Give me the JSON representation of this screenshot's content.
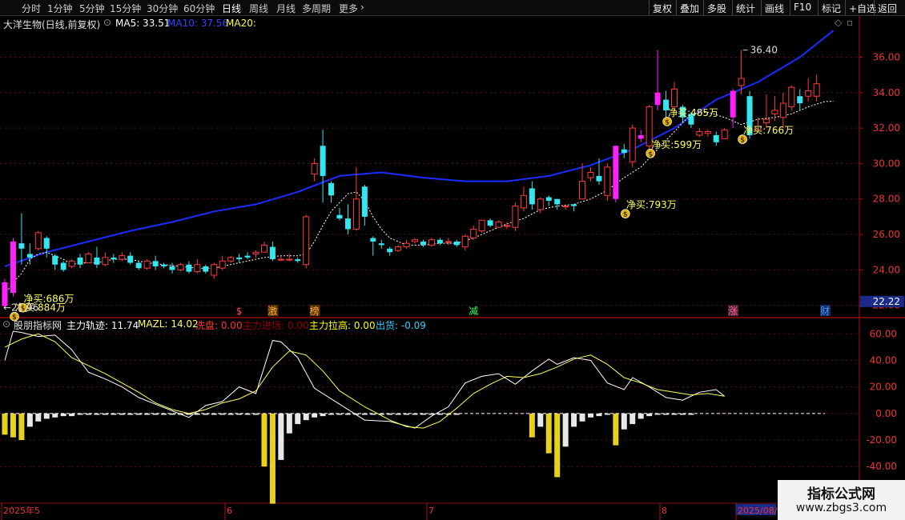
{
  "toolbar": {
    "periods": [
      "分时",
      "1分钟",
      "5分钟",
      "15分钟",
      "30分钟",
      "60分钟",
      "日线",
      "周线",
      "月线",
      "多周期",
      "更多"
    ],
    "active_period": "日线",
    "right_buttons": [
      "复权",
      "叠加",
      "多股",
      "统计",
      "画线",
      "F10",
      "标记",
      "+自选",
      "返回"
    ]
  },
  "main_header": {
    "stock": "大洋生物(日线,前复权)",
    "ma5_label": "MA5: 33.51",
    "ma10_label": "MA10: 37.56",
    "ma20_label": "MA20:"
  },
  "sub_header": {
    "name": "股朋指标网",
    "items": [
      {
        "text": "主力轨迹: 11.74",
        "color": "#ffffff"
      },
      {
        "text": "MAZL: 14.02",
        "color": "#ffff66"
      },
      {
        "text": "洗盘: 0.00",
        "color": "#ff3333"
      },
      {
        "text": "主力进场: 0.00",
        "color": "#990000"
      },
      {
        "text": "主力拉高: 0.00",
        "color": "#ffff00"
      },
      {
        "text": "出货: -0.09",
        "color": "#33ccff"
      }
    ]
  },
  "price_axis": [
    "36.00",
    "34.00",
    "32.00",
    "30.00",
    "28.00",
    "26.00",
    "24.00",
    "22.00"
  ],
  "price_tag": "22.22",
  "ind_axis": [
    "60.00",
    "40.00",
    "20.00",
    "0.00",
    "-20.00",
    "-40.00"
  ],
  "date_labels": [
    "2025年5",
    "6",
    "7",
    "8",
    "2025/08/"
  ],
  "annotations": {
    "high_price": "36.40",
    "low_price": "21.96",
    "buys": [
      "净买:884万",
      "净买:686万",
      "净买:793万",
      "净买:599万",
      "净买:485万",
      "净买:766万"
    ],
    "event_markers": [
      "$",
      "激",
      "榜",
      "减",
      "涨",
      "财"
    ]
  },
  "watermark": {
    "title": "指标公式网",
    "url": "www.zbgs3.com"
  },
  "chart_data": {
    "type": "candlestick",
    "ylim": [
      21.4,
      37.6
    ],
    "candles": [
      [
        21.96,
        23.3,
        22.0,
        23.5
      ],
      [
        22.7,
        25.6,
        22.5,
        25.8
      ],
      [
        25.5,
        25.2,
        24.3,
        27.2
      ],
      [
        24.9,
        24.7,
        24.3,
        25.5
      ],
      [
        25.2,
        26.1,
        25.1,
        26.2
      ],
      [
        25.8,
        25.2,
        24.7,
        25.9
      ],
      [
        24.8,
        24.3,
        24.0,
        24.9
      ],
      [
        24.4,
        24.0,
        23.9,
        24.5
      ],
      [
        24.2,
        24.5,
        24.1,
        24.6
      ],
      [
        24.7,
        24.3,
        24.1,
        24.9
      ],
      [
        24.4,
        24.9,
        24.4,
        25.0
      ],
      [
        24.7,
        24.3,
        24.1,
        25.3
      ],
      [
        24.3,
        24.7,
        24.2,
        25.0
      ],
      [
        24.7,
        24.6,
        24.4,
        24.9
      ],
      [
        24.6,
        24.8,
        24.5,
        25.0
      ],
      [
        24.8,
        24.4,
        24.3,
        25.0
      ],
      [
        24.4,
        24.1,
        24.0,
        24.5
      ],
      [
        24.1,
        24.5,
        24.0,
        24.6
      ],
      [
        24.5,
        24.2,
        24.0,
        24.8
      ],
      [
        24.3,
        24.2,
        24.1,
        24.4
      ],
      [
        24.2,
        24.0,
        23.8,
        24.4
      ],
      [
        24.0,
        24.3,
        23.9,
        24.4
      ],
      [
        24.3,
        23.9,
        23.8,
        24.5
      ],
      [
        23.9,
        24.3,
        23.8,
        24.6
      ],
      [
        24.2,
        23.9,
        23.8,
        24.3
      ],
      [
        23.7,
        24.3,
        23.5,
        24.4
      ],
      [
        24.1,
        24.5,
        24.0,
        24.8
      ],
      [
        24.5,
        24.7,
        24.4,
        24.8
      ],
      [
        24.7,
        24.6,
        24.4,
        24.9
      ],
      [
        24.8,
        24.7,
        24.6,
        25.0
      ],
      [
        24.9,
        25.0,
        24.7,
        25.1
      ],
      [
        25.0,
        25.4,
        25.0,
        25.6
      ],
      [
        25.3,
        24.6,
        24.5,
        25.6
      ],
      [
        24.6,
        24.6,
        24.5,
        24.8
      ],
      [
        24.6,
        24.6,
        24.5,
        24.9
      ],
      [
        24.6,
        24.5,
        24.4,
        24.7
      ],
      [
        24.3,
        27.0,
        24.1,
        27.1
      ],
      [
        29.4,
        30.0,
        29.0,
        30.3
      ],
      [
        31.0,
        29.3,
        27.8,
        31.9
      ],
      [
        28.9,
        28.2,
        27.8,
        29.0
      ],
      [
        27.1,
        26.9,
        26.8,
        27.5
      ],
      [
        26.9,
        26.3,
        26.0,
        27.7
      ],
      [
        26.3,
        28.0,
        26.2,
        29.8
      ],
      [
        28.7,
        27.0,
        26.5,
        28.8
      ],
      [
        25.8,
        25.6,
        24.8,
        25.9
      ],
      [
        25.5,
        25.4,
        25.2,
        25.7
      ],
      [
        25.2,
        25.0,
        24.8,
        25.3
      ],
      [
        25.1,
        25.3,
        25.0,
        25.4
      ],
      [
        25.3,
        25.5,
        25.2,
        25.7
      ],
      [
        25.6,
        25.7,
        25.5,
        25.8
      ],
      [
        25.6,
        25.4,
        25.3,
        25.7
      ],
      [
        25.4,
        25.7,
        25.3,
        25.8
      ],
      [
        25.7,
        25.5,
        25.4,
        25.8
      ],
      [
        25.6,
        25.6,
        25.4,
        25.8
      ],
      [
        25.6,
        25.4,
        25.3,
        25.7
      ],
      [
        25.3,
        25.9,
        25.1,
        26.0
      ],
      [
        25.8,
        26.3,
        25.7,
        26.5
      ],
      [
        26.2,
        26.8,
        26.1,
        26.8
      ],
      [
        26.8,
        26.5,
        26.4,
        26.9
      ],
      [
        26.4,
        26.7,
        26.4,
        26.8
      ],
      [
        26.5,
        26.5,
        26.3,
        26.7
      ],
      [
        26.4,
        27.6,
        26.2,
        27.8
      ],
      [
        27.5,
        28.2,
        27.3,
        28.7
      ],
      [
        28.6,
        27.7,
        27.4,
        29.0
      ],
      [
        27.4,
        28.0,
        27.2,
        28.1
      ],
      [
        28.1,
        27.9,
        27.6,
        28.2
      ],
      [
        28.0,
        27.7,
        27.4,
        28.0
      ],
      [
        27.6,
        27.6,
        27.4,
        27.7
      ],
      [
        27.7,
        27.6,
        27.3,
        27.7
      ],
      [
        28.0,
        29.0,
        28.0,
        30.0
      ],
      [
        29.2,
        29.5,
        29.0,
        29.8
      ],
      [
        29.3,
        29.0,
        28.8,
        30.3
      ],
      [
        28.2,
        29.8,
        27.9,
        30.0
      ],
      [
        28.0,
        31.0,
        27.8,
        31.0
      ],
      [
        30.8,
        30.6,
        30.3,
        31.1
      ],
      [
        30.1,
        32.0,
        29.8,
        32.2
      ],
      [
        31.4,
        31.6,
        31.2,
        31.9
      ],
      [
        31.0,
        33.2,
        30.8,
        33.3
      ],
      [
        33.3,
        34.0,
        33.0,
        36.4
      ],
      [
        33.6,
        33.0,
        32.6,
        34.1
      ],
      [
        33.2,
        34.2,
        33.0,
        34.6
      ],
      [
        33.2,
        32.6,
        32.3,
        33.3
      ],
      [
        32.8,
        32.2,
        32.0,
        32.9
      ],
      [
        31.6,
        31.8,
        31.5,
        32.0
      ],
      [
        31.7,
        31.8,
        31.5,
        31.9
      ],
      [
        31.6,
        31.2,
        31.0,
        31.8
      ],
      [
        31.4,
        31.9,
        31.4,
        32.0
      ],
      [
        32.6,
        34.1,
        32.0,
        34.2
      ],
      [
        34.4,
        34.8,
        33.9,
        36.4
      ],
      [
        33.8,
        31.6,
        31.4,
        34.1
      ],
      [
        31.9,
        32.1,
        31.9,
        32.6
      ],
      [
        32.3,
        32.5,
        32.0,
        33.9
      ],
      [
        32.8,
        33.0,
        32.4,
        33.8
      ],
      [
        32.6,
        33.4,
        32.0,
        34.0
      ],
      [
        33.2,
        34.3,
        33.0,
        34.4
      ],
      [
        33.8,
        33.4,
        33.0,
        34.2
      ],
      [
        33.8,
        34.1,
        33.5,
        34.8
      ],
      [
        33.8,
        34.5,
        33.5,
        35.0
      ]
    ],
    "buy_candles": [
      0,
      1,
      73,
      76,
      78,
      87
    ],
    "ma10": [
      [
        0,
        24.2
      ],
      [
        5,
        25.0
      ],
      [
        10,
        25.6
      ],
      [
        15,
        26.2
      ],
      [
        20,
        26.7
      ],
      [
        25,
        27.3
      ],
      [
        30,
        27.7
      ],
      [
        35,
        28.4
      ],
      [
        40,
        29.3
      ],
      [
        45,
        29.5
      ],
      [
        50,
        29.2
      ],
      [
        55,
        29.0
      ],
      [
        60,
        29.0
      ],
      [
        65,
        29.3
      ],
      [
        70,
        29.9
      ],
      [
        75,
        30.8
      ],
      [
        80,
        32.0
      ],
      [
        85,
        33.6
      ],
      [
        90,
        34.6
      ],
      [
        95,
        36.0
      ],
      [
        99,
        37.5
      ]
    ],
    "ma5": [
      [
        0,
        22.6
      ],
      [
        1,
        23.3
      ],
      [
        2,
        23.8
      ],
      [
        3,
        24.6
      ],
      [
        4,
        24.9
      ],
      [
        5,
        25.0
      ],
      [
        6,
        24.8
      ],
      [
        7,
        24.6
      ],
      [
        8,
        24.3
      ],
      [
        9,
        24.4
      ],
      [
        11,
        24.4
      ],
      [
        13,
        24.6
      ],
      [
        15,
        24.6
      ],
      [
        17,
        24.4
      ],
      [
        19,
        24.3
      ],
      [
        21,
        24.2
      ],
      [
        23,
        24.1
      ],
      [
        25,
        24.1
      ],
      [
        27,
        24.3
      ],
      [
        29,
        24.5
      ],
      [
        31,
        24.7
      ],
      [
        33,
        24.8
      ],
      [
        35,
        24.8
      ],
      [
        36,
        24.9
      ],
      [
        37,
        25.6
      ],
      [
        38,
        26.5
      ],
      [
        39,
        27.3
      ],
      [
        40,
        27.8
      ],
      [
        41,
        28.3
      ],
      [
        42,
        28.4
      ],
      [
        43,
        27.9
      ],
      [
        44,
        27.0
      ],
      [
        45,
        26.3
      ],
      [
        46,
        25.8
      ],
      [
        48,
        25.4
      ],
      [
        50,
        25.4
      ],
      [
        52,
        25.5
      ],
      [
        54,
        25.5
      ],
      [
        56,
        25.8
      ],
      [
        58,
        26.2
      ],
      [
        60,
        26.6
      ],
      [
        62,
        26.9
      ],
      [
        64,
        27.4
      ],
      [
        66,
        27.6
      ],
      [
        68,
        27.7
      ],
      [
        70,
        28.0
      ],
      [
        72,
        28.5
      ],
      [
        74,
        29.2
      ],
      [
        76,
        29.8
      ],
      [
        78,
        30.8
      ],
      [
        80,
        31.8
      ],
      [
        82,
        32.8
      ],
      [
        84,
        32.9
      ],
      [
        86,
        32.6
      ],
      [
        88,
        32.2
      ],
      [
        90,
        32.5
      ],
      [
        92,
        32.6
      ],
      [
        94,
        32.8
      ],
      [
        96,
        33.2
      ],
      [
        98,
        33.5
      ],
      [
        99,
        33.51
      ]
    ],
    "main_line": [
      [
        0,
        40
      ],
      [
        1,
        62
      ],
      [
        2,
        61
      ],
      [
        4,
        58
      ],
      [
        6,
        59
      ],
      [
        8,
        48
      ],
      [
        10,
        31
      ],
      [
        12,
        26
      ],
      [
        14,
        20
      ],
      [
        16,
        12
      ],
      [
        18,
        7
      ],
      [
        20,
        2
      ],
      [
        22,
        -3
      ],
      [
        24,
        6
      ],
      [
        26,
        9
      ],
      [
        28,
        20
      ],
      [
        30,
        15
      ],
      [
        32,
        55
      ],
      [
        33,
        54
      ],
      [
        35,
        42
      ],
      [
        37,
        19
      ],
      [
        40,
        7
      ],
      [
        43,
        -5
      ],
      [
        46,
        -6
      ],
      [
        49,
        -11
      ],
      [
        51,
        -2
      ],
      [
        53,
        5
      ],
      [
        55,
        23
      ],
      [
        57,
        28
      ],
      [
        59,
        30
      ],
      [
        61,
        22
      ],
      [
        63,
        32
      ],
      [
        65,
        41
      ],
      [
        66,
        37
      ],
      [
        68,
        42
      ],
      [
        70,
        40
      ],
      [
        72,
        23
      ],
      [
        74,
        18
      ],
      [
        75,
        27
      ],
      [
        77,
        20
      ],
      [
        79,
        12
      ],
      [
        81,
        10
      ],
      [
        83,
        16
      ],
      [
        85,
        18
      ],
      [
        86,
        13
      ]
    ],
    "mazl_line": [
      [
        0,
        50
      ],
      [
        2,
        56
      ],
      [
        4,
        60
      ],
      [
        6,
        54
      ],
      [
        8,
        42
      ],
      [
        10,
        36
      ],
      [
        12,
        30
      ],
      [
        14,
        23
      ],
      [
        16,
        16
      ],
      [
        18,
        8
      ],
      [
        20,
        3
      ],
      [
        22,
        0
      ],
      [
        24,
        3
      ],
      [
        26,
        8
      ],
      [
        28,
        11
      ],
      [
        30,
        17
      ],
      [
        32,
        35
      ],
      [
        34,
        47
      ],
      [
        36,
        44
      ],
      [
        38,
        32
      ],
      [
        40,
        17
      ],
      [
        43,
        5
      ],
      [
        46,
        -5
      ],
      [
        48,
        -10
      ],
      [
        50,
        -11
      ],
      [
        52,
        -6
      ],
      [
        54,
        4
      ],
      [
        56,
        15
      ],
      [
        58,
        22
      ],
      [
        60,
        28
      ],
      [
        62,
        27
      ],
      [
        64,
        30
      ],
      [
        66,
        35
      ],
      [
        68,
        41
      ],
      [
        70,
        44
      ],
      [
        72,
        37
      ],
      [
        74,
        27
      ],
      [
        76,
        23
      ],
      [
        78,
        18
      ],
      [
        80,
        16
      ],
      [
        82,
        14
      ],
      [
        84,
        15
      ],
      [
        86,
        13
      ]
    ],
    "hist_bars": [
      [
        0,
        -16
      ],
      [
        1,
        -18
      ],
      [
        2,
        -20
      ],
      [
        3,
        -10
      ],
      [
        4,
        -6
      ],
      [
        5,
        -4
      ],
      [
        6,
        -3
      ],
      [
        7,
        -2
      ],
      [
        8,
        -2
      ],
      [
        9,
        -1
      ],
      [
        10,
        -1
      ],
      [
        11,
        -1
      ],
      [
        12,
        -1
      ],
      [
        13,
        -1
      ],
      [
        14,
        -1
      ],
      [
        15,
        -1
      ],
      [
        16,
        -1
      ],
      [
        17,
        -1
      ],
      [
        18,
        -1
      ],
      [
        19,
        -1
      ],
      [
        20,
        -1
      ],
      [
        21,
        -1
      ],
      [
        22,
        -1
      ],
      [
        23,
        -1
      ],
      [
        24,
        -1
      ],
      [
        25,
        -1
      ],
      [
        26,
        -1
      ],
      [
        27,
        -1
      ],
      [
        28,
        -1
      ],
      [
        29,
        -1
      ],
      [
        30,
        -1
      ],
      [
        31,
        -40
      ],
      [
        32,
        -68
      ],
      [
        33,
        -35
      ],
      [
        34,
        -15
      ],
      [
        35,
        -8
      ],
      [
        36,
        -5
      ],
      [
        37,
        -3
      ],
      [
        38,
        -2
      ],
      [
        39,
        -1
      ],
      [
        40,
        -1
      ],
      [
        41,
        -1
      ],
      [
        42,
        -1
      ],
      [
        43,
        -1
      ],
      [
        44,
        -1
      ],
      [
        45,
        -1
      ],
      [
        46,
        -1
      ],
      [
        47,
        -1
      ],
      [
        48,
        -1
      ],
      [
        49,
        -1
      ],
      [
        50,
        -1
      ],
      [
        51,
        -1
      ],
      [
        52,
        -1
      ],
      [
        53,
        -1
      ],
      [
        54,
        -1
      ],
      [
        63,
        -18
      ],
      [
        64,
        -10
      ],
      [
        65,
        -30
      ],
      [
        66,
        -48
      ],
      [
        67,
        -25
      ],
      [
        68,
        -10
      ],
      [
        69,
        -6
      ],
      [
        70,
        -3
      ],
      [
        71,
        -2
      ],
      [
        72,
        -1
      ],
      [
        73,
        -24
      ],
      [
        74,
        -12
      ],
      [
        75,
        -8
      ],
      [
        76,
        -4
      ],
      [
        77,
        -2
      ],
      [
        78,
        -1
      ],
      [
        79,
        -1
      ],
      [
        80,
        -1
      ],
      [
        81,
        -1
      ],
      [
        82,
        -1
      ]
    ],
    "hist_yellow": [
      0,
      1,
      2,
      31,
      32,
      63,
      65,
      66,
      73
    ],
    "ind_ylim": [
      -67,
      68
    ]
  }
}
